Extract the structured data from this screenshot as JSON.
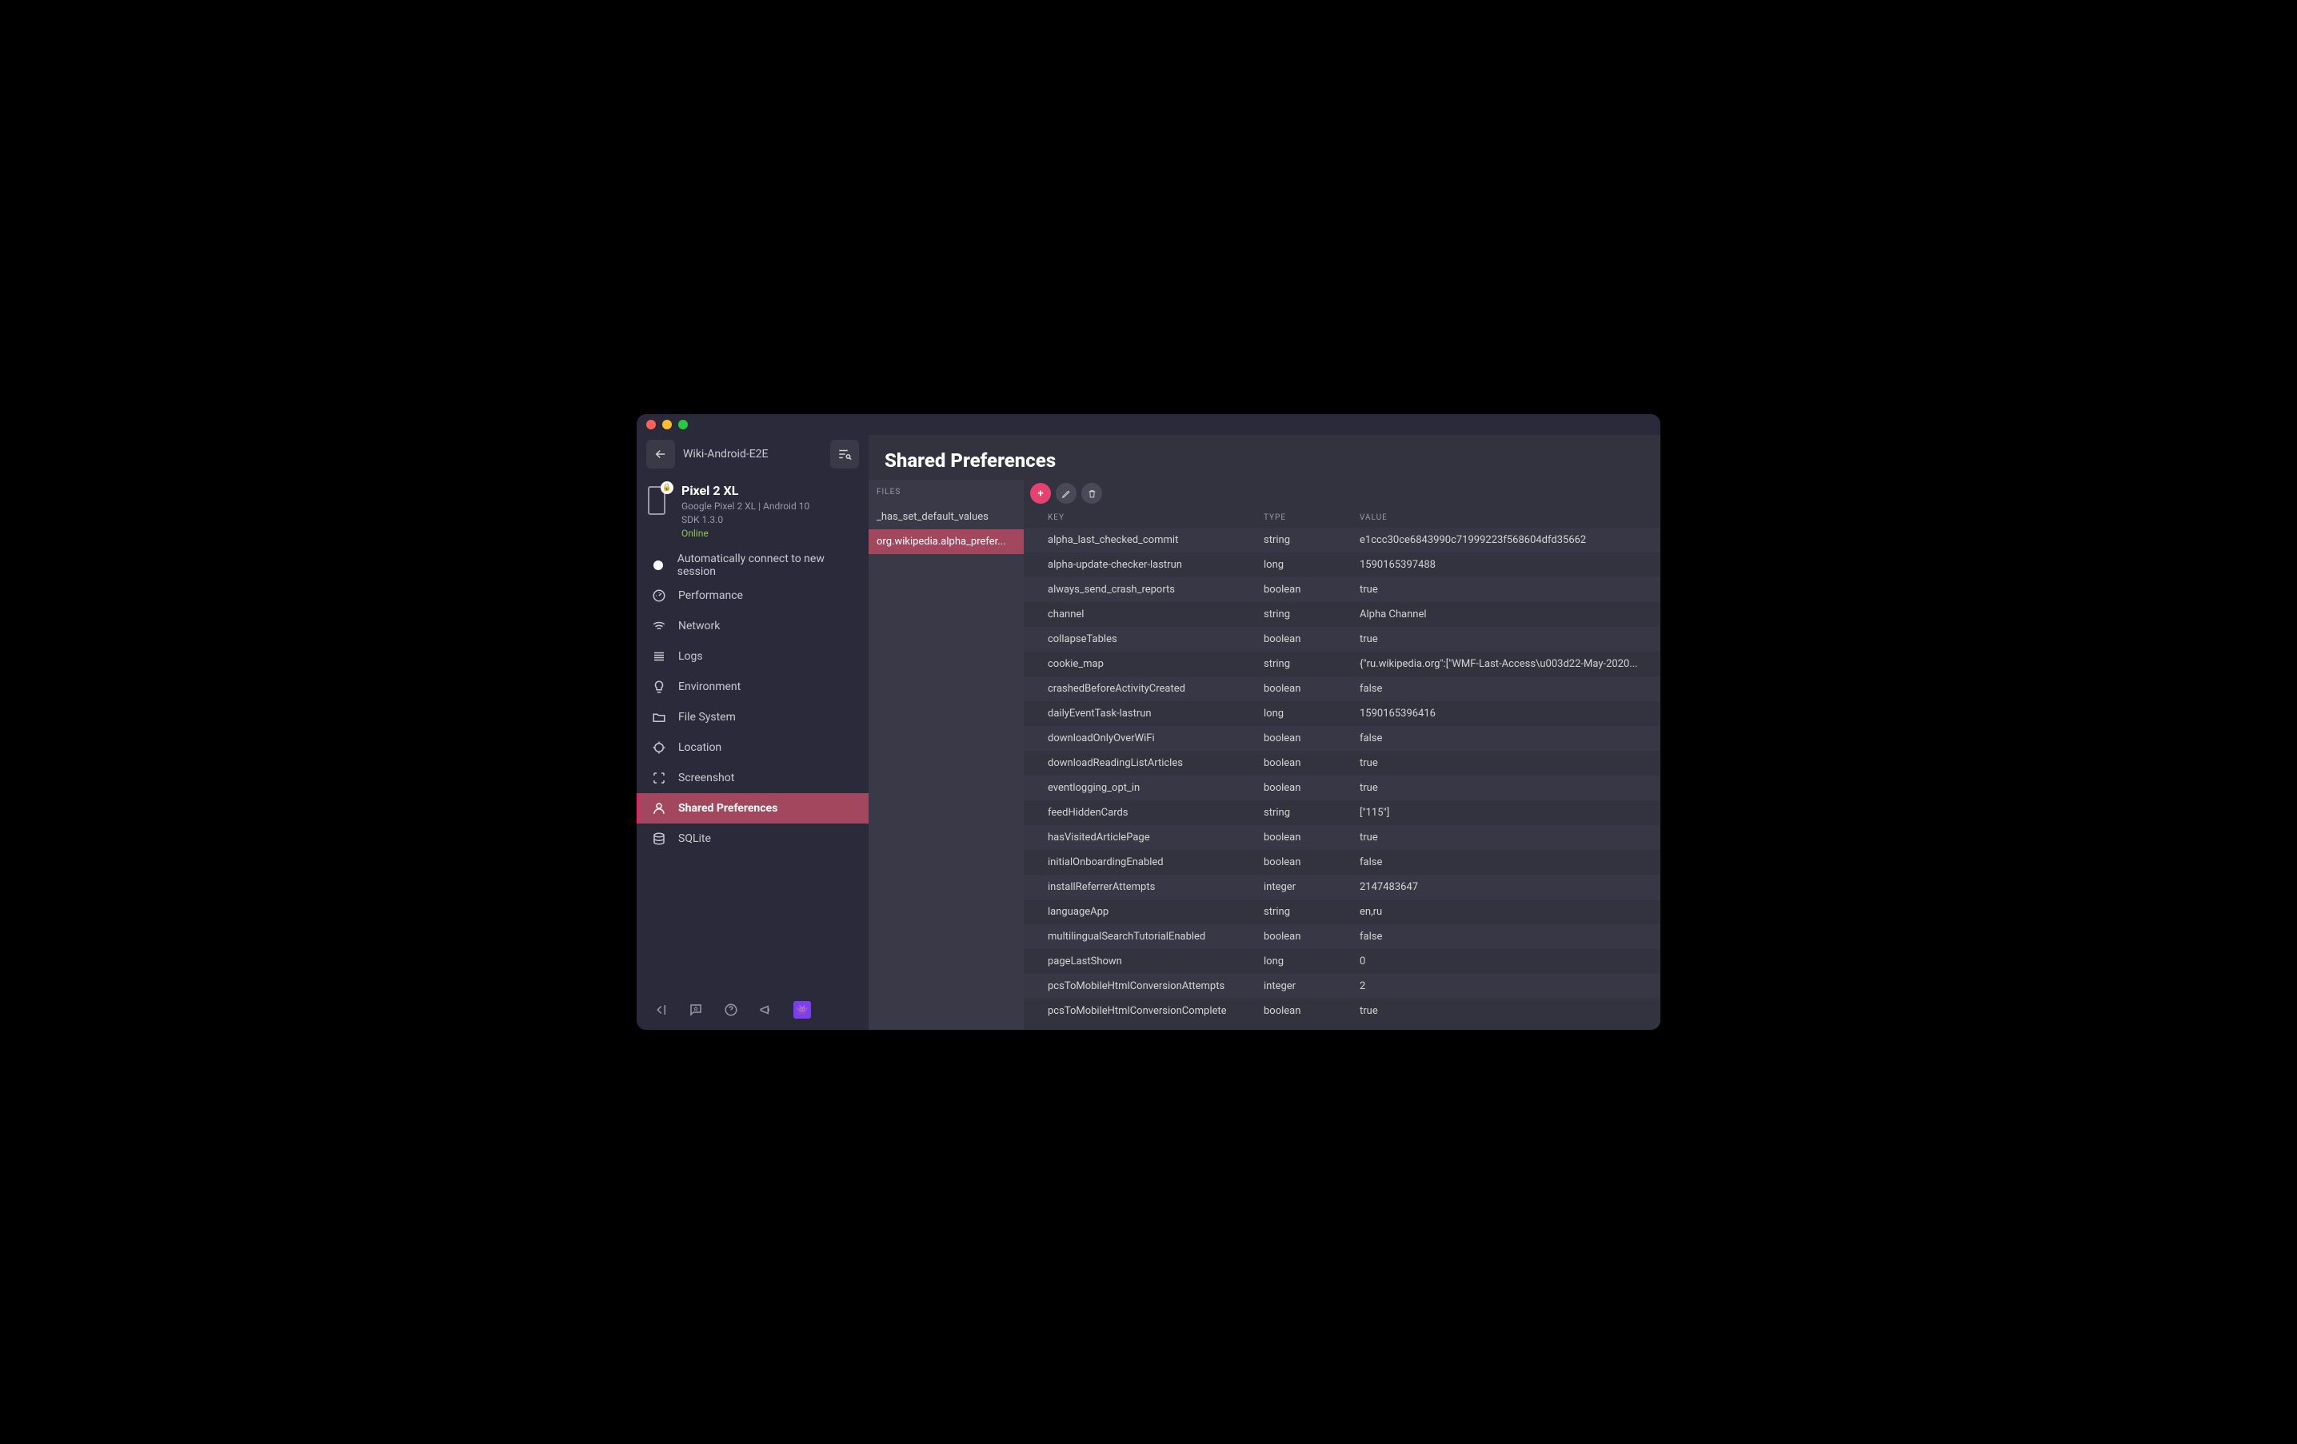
{
  "topbar": {
    "breadcrumb": "Wiki-Android-E2E"
  },
  "device": {
    "name": "Pixel 2 XL",
    "sub": "Google Pixel 2 XL | Android 10",
    "sdk": "SDK 1.3.0",
    "status": "Online"
  },
  "nav": {
    "autoconnect": "Automatically connect to new session",
    "items": [
      {
        "label": "Performance",
        "icon": "gauge"
      },
      {
        "label": "Network",
        "icon": "wifi"
      },
      {
        "label": "Logs",
        "icon": "lines"
      },
      {
        "label": "Environment",
        "icon": "bulb"
      },
      {
        "label": "File System",
        "icon": "folder"
      },
      {
        "label": "Location",
        "icon": "target"
      },
      {
        "label": "Screenshot",
        "icon": "frame"
      },
      {
        "label": "Shared Preferences",
        "icon": "person",
        "active": true
      },
      {
        "label": "SQLite",
        "icon": "db"
      }
    ]
  },
  "page_title": "Shared Preferences",
  "files_header": "FILES",
  "files": [
    {
      "name": "_has_set_default_values"
    },
    {
      "name": "org.wikipedia.alpha_prefer...",
      "selected": true
    }
  ],
  "table": {
    "headers": {
      "key": "KEY",
      "type": "TYPE",
      "value": "VALUE"
    },
    "rows": [
      {
        "key": "alpha_last_checked_commit",
        "type": "string",
        "value": "e1ccc30ce6843990c71999223f568604dfd35662"
      },
      {
        "key": "alpha-update-checker-lastrun",
        "type": "long",
        "value": "1590165397488"
      },
      {
        "key": "always_send_crash_reports",
        "type": "boolean",
        "value": "true"
      },
      {
        "key": "channel",
        "type": "string",
        "value": "Alpha Channel"
      },
      {
        "key": "collapseTables",
        "type": "boolean",
        "value": "true"
      },
      {
        "key": "cookie_map",
        "type": "string",
        "value": "{\"ru.wikipedia.org\":[\"WMF-Last-Access\\u003d22-May-2020..."
      },
      {
        "key": "crashedBeforeActivityCreated",
        "type": "boolean",
        "value": "false"
      },
      {
        "key": "dailyEventTask-lastrun",
        "type": "long",
        "value": "1590165396416"
      },
      {
        "key": "downloadOnlyOverWiFi",
        "type": "boolean",
        "value": "false"
      },
      {
        "key": "downloadReadingListArticles",
        "type": "boolean",
        "value": "true"
      },
      {
        "key": "eventlogging_opt_in",
        "type": "boolean",
        "value": "true"
      },
      {
        "key": "feedHiddenCards",
        "type": "string",
        "value": "[\"115\"]"
      },
      {
        "key": "hasVisitedArticlePage",
        "type": "boolean",
        "value": "true"
      },
      {
        "key": "initialOnboardingEnabled",
        "type": "boolean",
        "value": "false"
      },
      {
        "key": "installReferrerAttempts",
        "type": "integer",
        "value": "2147483647"
      },
      {
        "key": "languageApp",
        "type": "string",
        "value": "en,ru"
      },
      {
        "key": "multilingualSearchTutorialEnabled",
        "type": "boolean",
        "value": "false"
      },
      {
        "key": "pageLastShown",
        "type": "long",
        "value": "0"
      },
      {
        "key": "pcsToMobileHtmlConversionAttempts",
        "type": "integer",
        "value": "2"
      },
      {
        "key": "pcsToMobileHtmlConversionComplete",
        "type": "boolean",
        "value": "true"
      }
    ]
  }
}
